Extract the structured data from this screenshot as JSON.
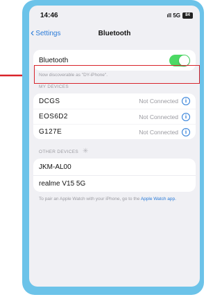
{
  "status_bar": {
    "time": "14:46",
    "signal": "ıll 5G",
    "battery": "84"
  },
  "nav": {
    "back_label": "Settings",
    "title": "Bluetooth"
  },
  "bluetooth": {
    "label": "Bluetooth",
    "enabled": true,
    "discoverable_note": "Now discoverable as \"DY-iPhone\"."
  },
  "my_devices": {
    "header": "MY DEVICES",
    "items": [
      {
        "name": "DCGS",
        "status": "Not Connected"
      },
      {
        "name": "EOS6D2",
        "status": "Not Connected"
      },
      {
        "name": "G127E",
        "status": "Not Connected"
      }
    ]
  },
  "other_devices": {
    "header": "OTHER DEVICES",
    "items": [
      {
        "name": "JKM-AL00"
      },
      {
        "name": "realme V15 5G"
      }
    ]
  },
  "pair_note": {
    "text": "To pair an Apple Watch with your iPhone, go to the",
    "link": "Apple Watch app."
  },
  "colors": {
    "accent": "#2a7bd8",
    "toggle_on": "#4cd964",
    "highlight": "#d9232a",
    "frame": "#6cc3e9"
  }
}
